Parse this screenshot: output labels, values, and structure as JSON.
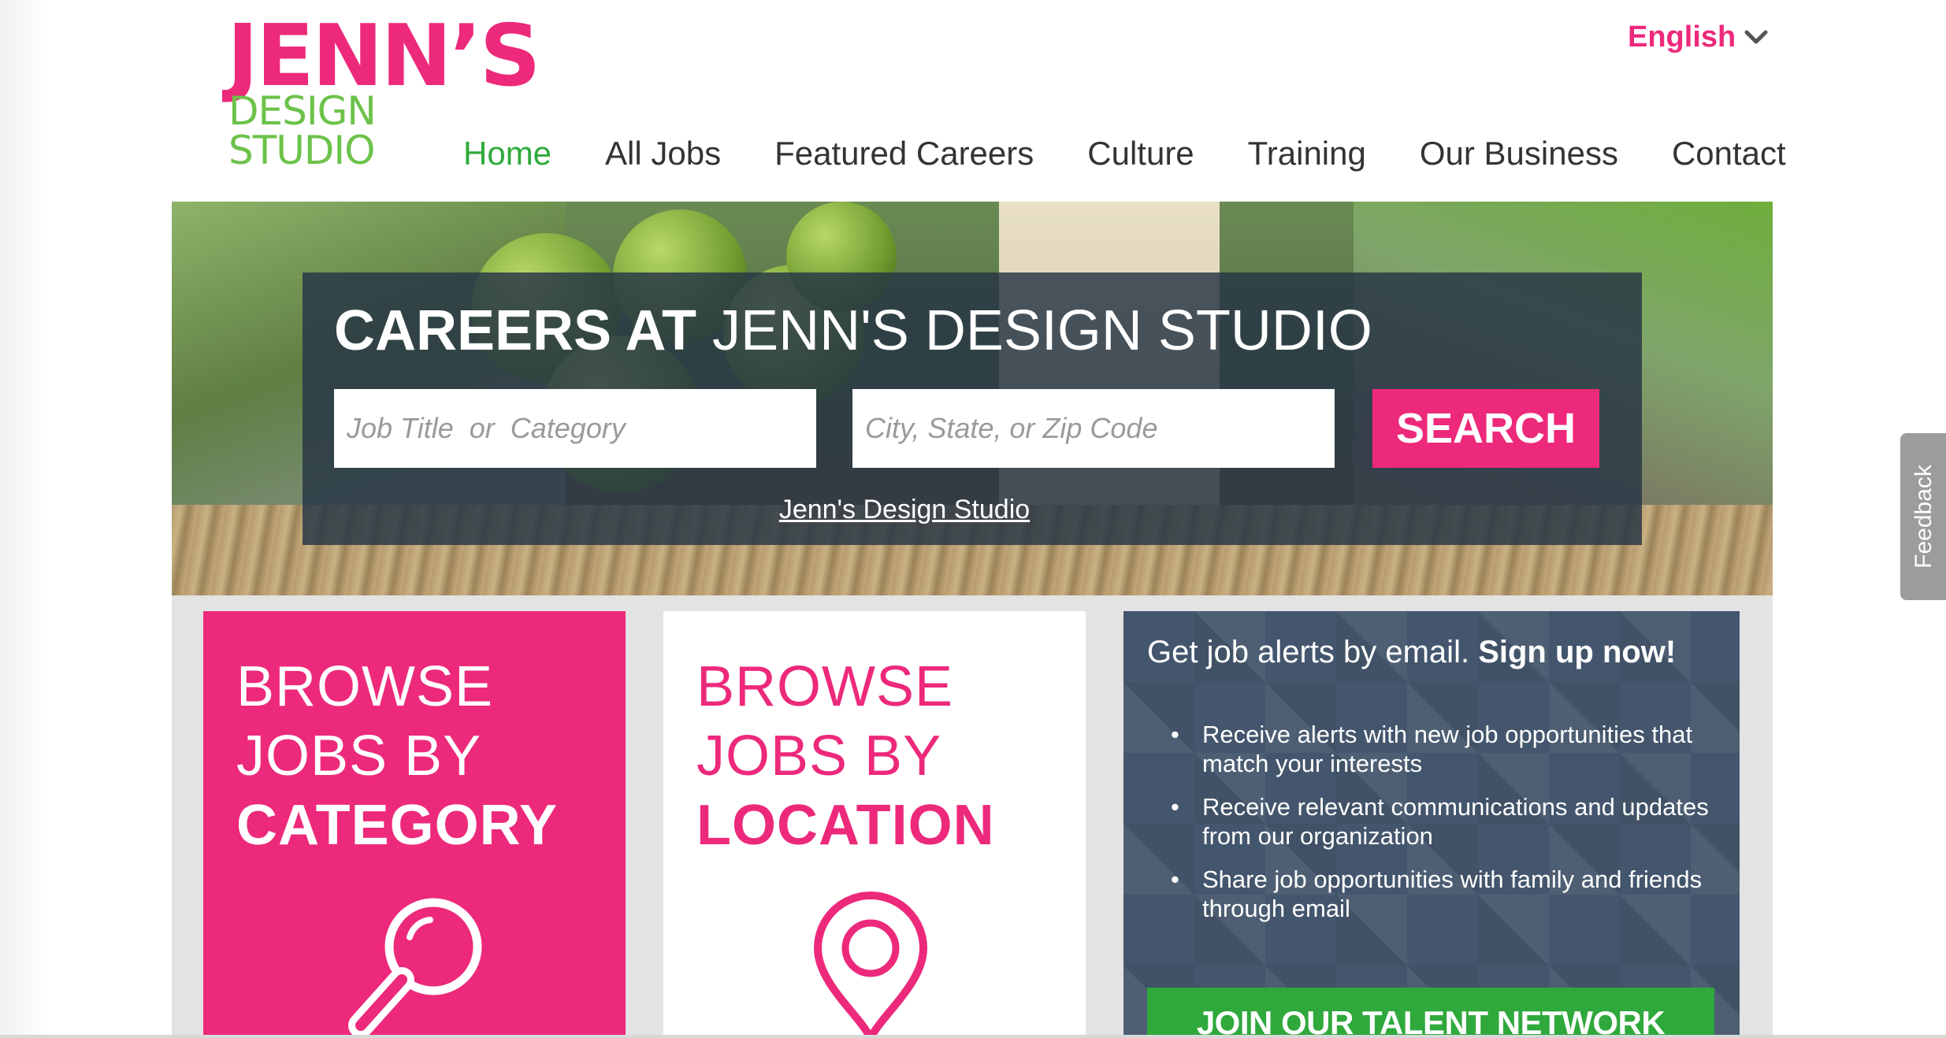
{
  "colors": {
    "brand_pink": "#ed297b",
    "brand_green": "#6cc24a",
    "nav_active": "#2eaa3a",
    "join_green": "#2fa83c",
    "alert_bg": "#44566d"
  },
  "logo": {
    "line1": "JENN’S",
    "line2": "DESIGN STUDIO"
  },
  "language": {
    "label": "English",
    "icon": "chevron-down-icon"
  },
  "nav": {
    "items": [
      {
        "label": "Home",
        "active": true
      },
      {
        "label": "All Jobs",
        "active": false
      },
      {
        "label": "Featured Careers",
        "active": false
      },
      {
        "label": "Culture",
        "active": false
      },
      {
        "label": "Training",
        "active": false
      },
      {
        "label": "Our Business",
        "active": false
      },
      {
        "label": "Contact",
        "active": false
      }
    ]
  },
  "hero": {
    "title_bold": "CAREERS AT",
    "title_light": "JENN'S DESIGN STUDIO",
    "keyword_placeholder": "Job Title  or  Category",
    "location_placeholder": "City, State, or Zip Code",
    "search_label": "SEARCH",
    "company_link": "Jenn's Design Studio"
  },
  "browse_category": {
    "line1": "BROWSE",
    "line2": "JOBS BY",
    "line3": "CATEGORY",
    "icon": "magnifier-icon"
  },
  "browse_location": {
    "line1": "BROWSE",
    "line2": "JOBS BY",
    "line3": "LOCATION",
    "icon": "map-pin-icon"
  },
  "alerts": {
    "title": "Get job alerts by email.",
    "title_bold": "Sign up now!",
    "items": [
      "Receive alerts with new job opportunities that match your interests",
      "Receive relevant communications and updates from our organization",
      "Share job opportunities with family and friends through email"
    ],
    "join_label": "JOIN OUR TALENT NETWORK"
  },
  "feedback": {
    "label": "Feedback"
  }
}
